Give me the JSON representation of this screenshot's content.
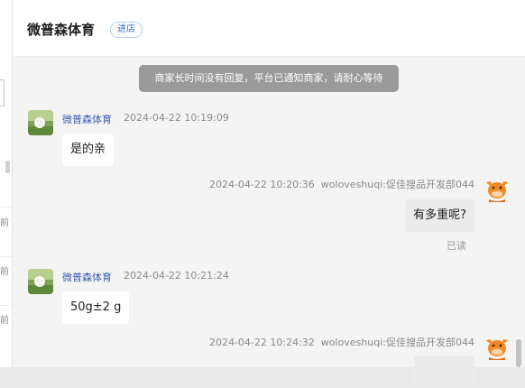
{
  "header": {
    "shop_name": "微普森体育",
    "enter_shop_label": "进店"
  },
  "notice": "商家长时间没有回复，平台已通知商家，请耐心等待",
  "left_glyphs": [
    "前",
    "前",
    "前"
  ],
  "messages": [
    {
      "direction": "in",
      "sender": "微普森体育",
      "time": "2024-04-22 10:19:09",
      "text": "是的亲"
    },
    {
      "direction": "out",
      "time": "2024-04-22 10:20:36",
      "sender": "woloveshuqi:促佳搜品开发部044",
      "text": "有多重呢?",
      "status": "已读"
    },
    {
      "direction": "in",
      "sender": "微普森体育",
      "time": "2024-04-22 10:21:24",
      "text": "50g±2 g"
    },
    {
      "direction": "out",
      "time": "2024-04-22 10:24:32",
      "sender": "woloveshuqi:促佳搜品开发部044",
      "text": ""
    }
  ],
  "colors": {
    "sender_link": "#3a58b3",
    "notice_bg": "#9a9a9a",
    "chat_bg": "#f4f4f5",
    "user_avatar": "#f08a24"
  },
  "icons": {
    "store_avatar": "golf-ball-on-grass-avatar-icon",
    "user_avatar": "cartoon-bull-avatar-icon"
  }
}
